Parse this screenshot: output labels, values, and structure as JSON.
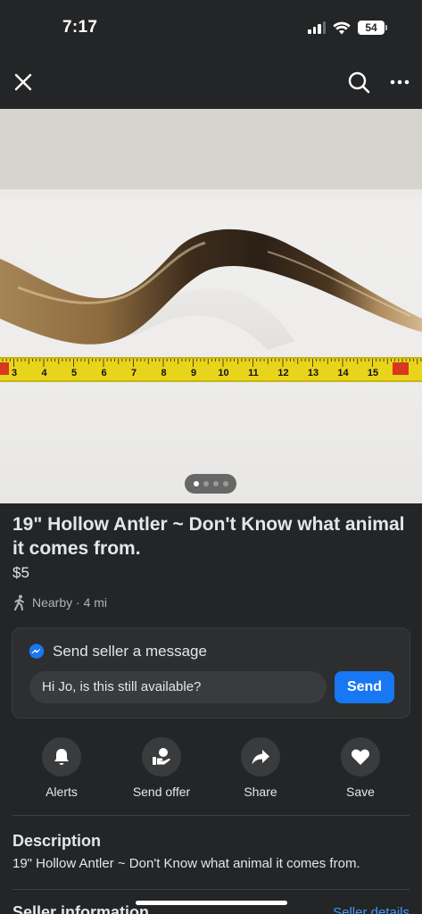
{
  "status_bar": {
    "time": "7:17",
    "battery": "54",
    "icons": [
      "cellular-signal-icon",
      "wifi-icon",
      "battery-icon"
    ]
  },
  "nav": {
    "close_icon": "close-icon",
    "search_icon": "search-icon",
    "more_icon": "more-icon"
  },
  "photo": {
    "page_count": 4,
    "active_index": 0,
    "tape_numbers": [
      "3",
      "4",
      "5",
      "6",
      "7",
      "8",
      "9",
      "10",
      "11",
      "12",
      "13",
      "14",
      "15"
    ]
  },
  "listing": {
    "title": "19\" Hollow Antler ~ Don't Know what animal it comes from.",
    "price": "$5",
    "location": "Nearby · 4 mi"
  },
  "message": {
    "heading": "Send seller a message",
    "input_value": "Hi Jo, is this still available?",
    "send_label": "Send"
  },
  "actions": [
    {
      "label": "Alerts",
      "icon": "bell-icon"
    },
    {
      "label": "Send offer",
      "icon": "send-offer-icon"
    },
    {
      "label": "Share",
      "icon": "share-icon"
    },
    {
      "label": "Save",
      "icon": "heart-icon"
    }
  ],
  "description": {
    "title": "Description",
    "text": "19\" Hollow Antler ~ Don't Know what animal it comes from."
  },
  "seller": {
    "title": "Seller information",
    "link": "Seller details"
  },
  "colors": {
    "background": "#242526",
    "accent": "#1877f2",
    "link": "#4599ff"
  }
}
